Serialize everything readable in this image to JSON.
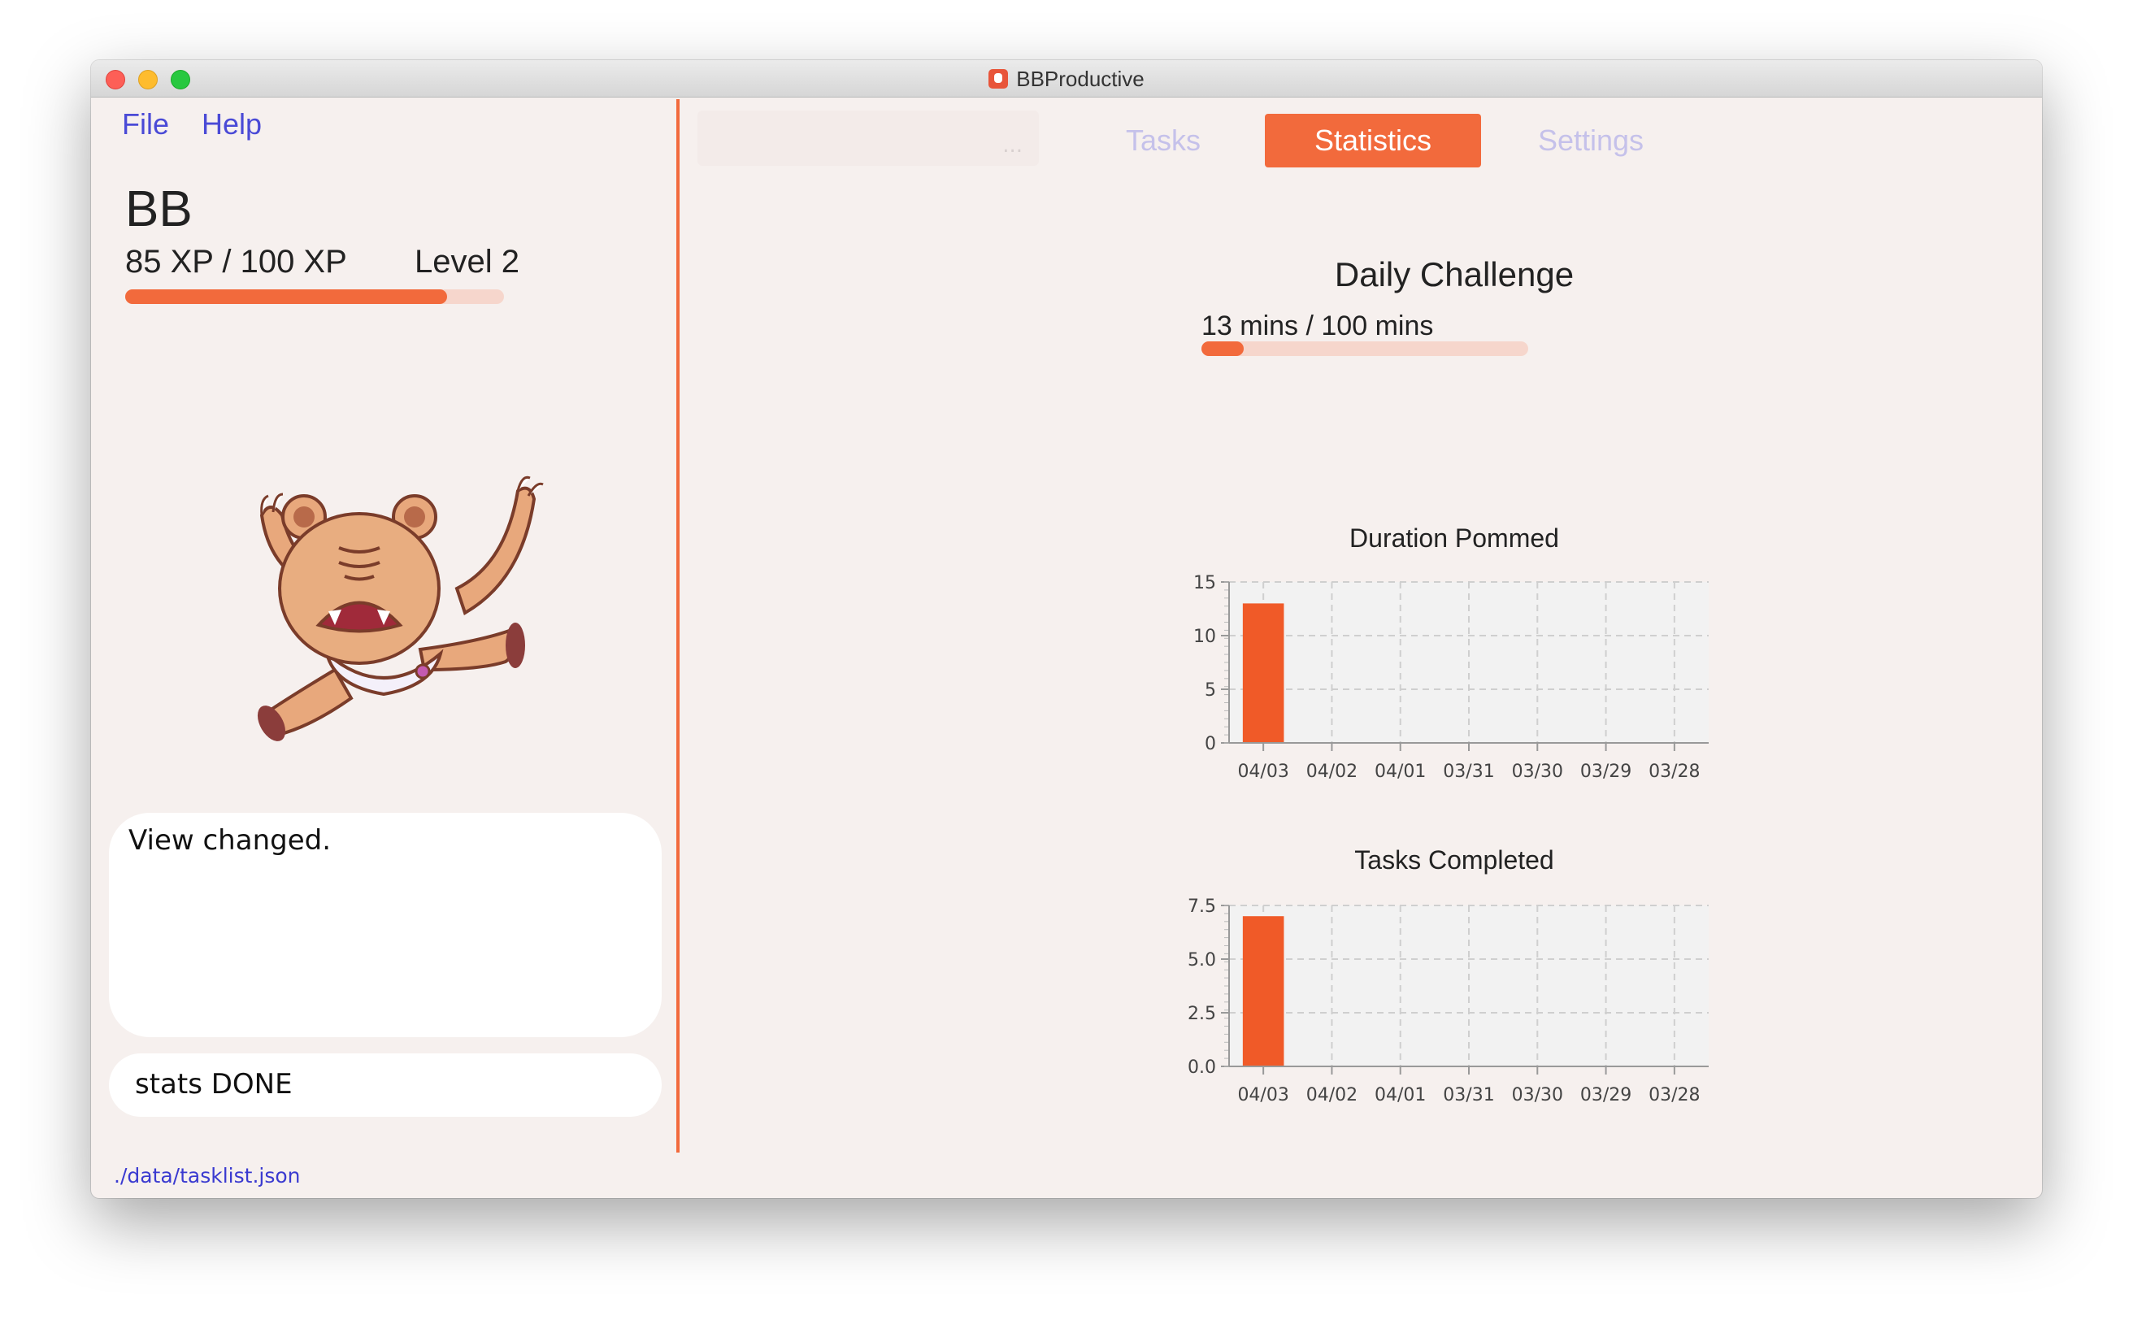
{
  "window": {
    "title": "BBProductive"
  },
  "menu": {
    "file": "File",
    "help": "Help"
  },
  "profile": {
    "name": "BB",
    "xp_text": "85 XP / 100 XP",
    "level_text": "Level 2",
    "xp_progress": 0.85
  },
  "result_display": {
    "text": "View changed."
  },
  "command_box": {
    "value": "stats DONE"
  },
  "status_bar": {
    "file_path": "./data/tasklist.json"
  },
  "tabs": {
    "blank_label": "...",
    "tasks": "Tasks",
    "statistics": "Statistics",
    "settings": "Settings",
    "active": "Statistics"
  },
  "daily_challenge": {
    "title": "Daily Challenge",
    "progress_text": "13 mins / 100 mins",
    "progress": 0.13
  },
  "colors": {
    "accent": "#f26a3c",
    "bar": "#f05a28",
    "link": "#4a4ad6",
    "tab_inactive": "#c5c1ea"
  },
  "chart_data": [
    {
      "type": "bar",
      "title": "Duration Pommed",
      "categories": [
        "04/03",
        "04/02",
        "04/01",
        "03/31",
        "03/30",
        "03/29",
        "03/28"
      ],
      "values": [
        13,
        0,
        0,
        0,
        0,
        0,
        0
      ],
      "ylim": [
        0,
        15
      ],
      "yticks": [
        "0",
        "5",
        "10",
        "15"
      ],
      "ytick_values": [
        0,
        5,
        10,
        15
      ],
      "grid": true,
      "legend": "none"
    },
    {
      "type": "bar",
      "title": "Tasks Completed",
      "categories": [
        "04/03",
        "04/02",
        "04/01",
        "03/31",
        "03/30",
        "03/29",
        "03/28"
      ],
      "values": [
        7,
        0,
        0,
        0,
        0,
        0,
        0
      ],
      "ylim": [
        0,
        7.5
      ],
      "yticks": [
        "0.0",
        "2.5",
        "5.0",
        "7.5"
      ],
      "ytick_values": [
        0,
        2.5,
        5,
        7.5
      ],
      "grid": true,
      "legend": "none"
    }
  ]
}
